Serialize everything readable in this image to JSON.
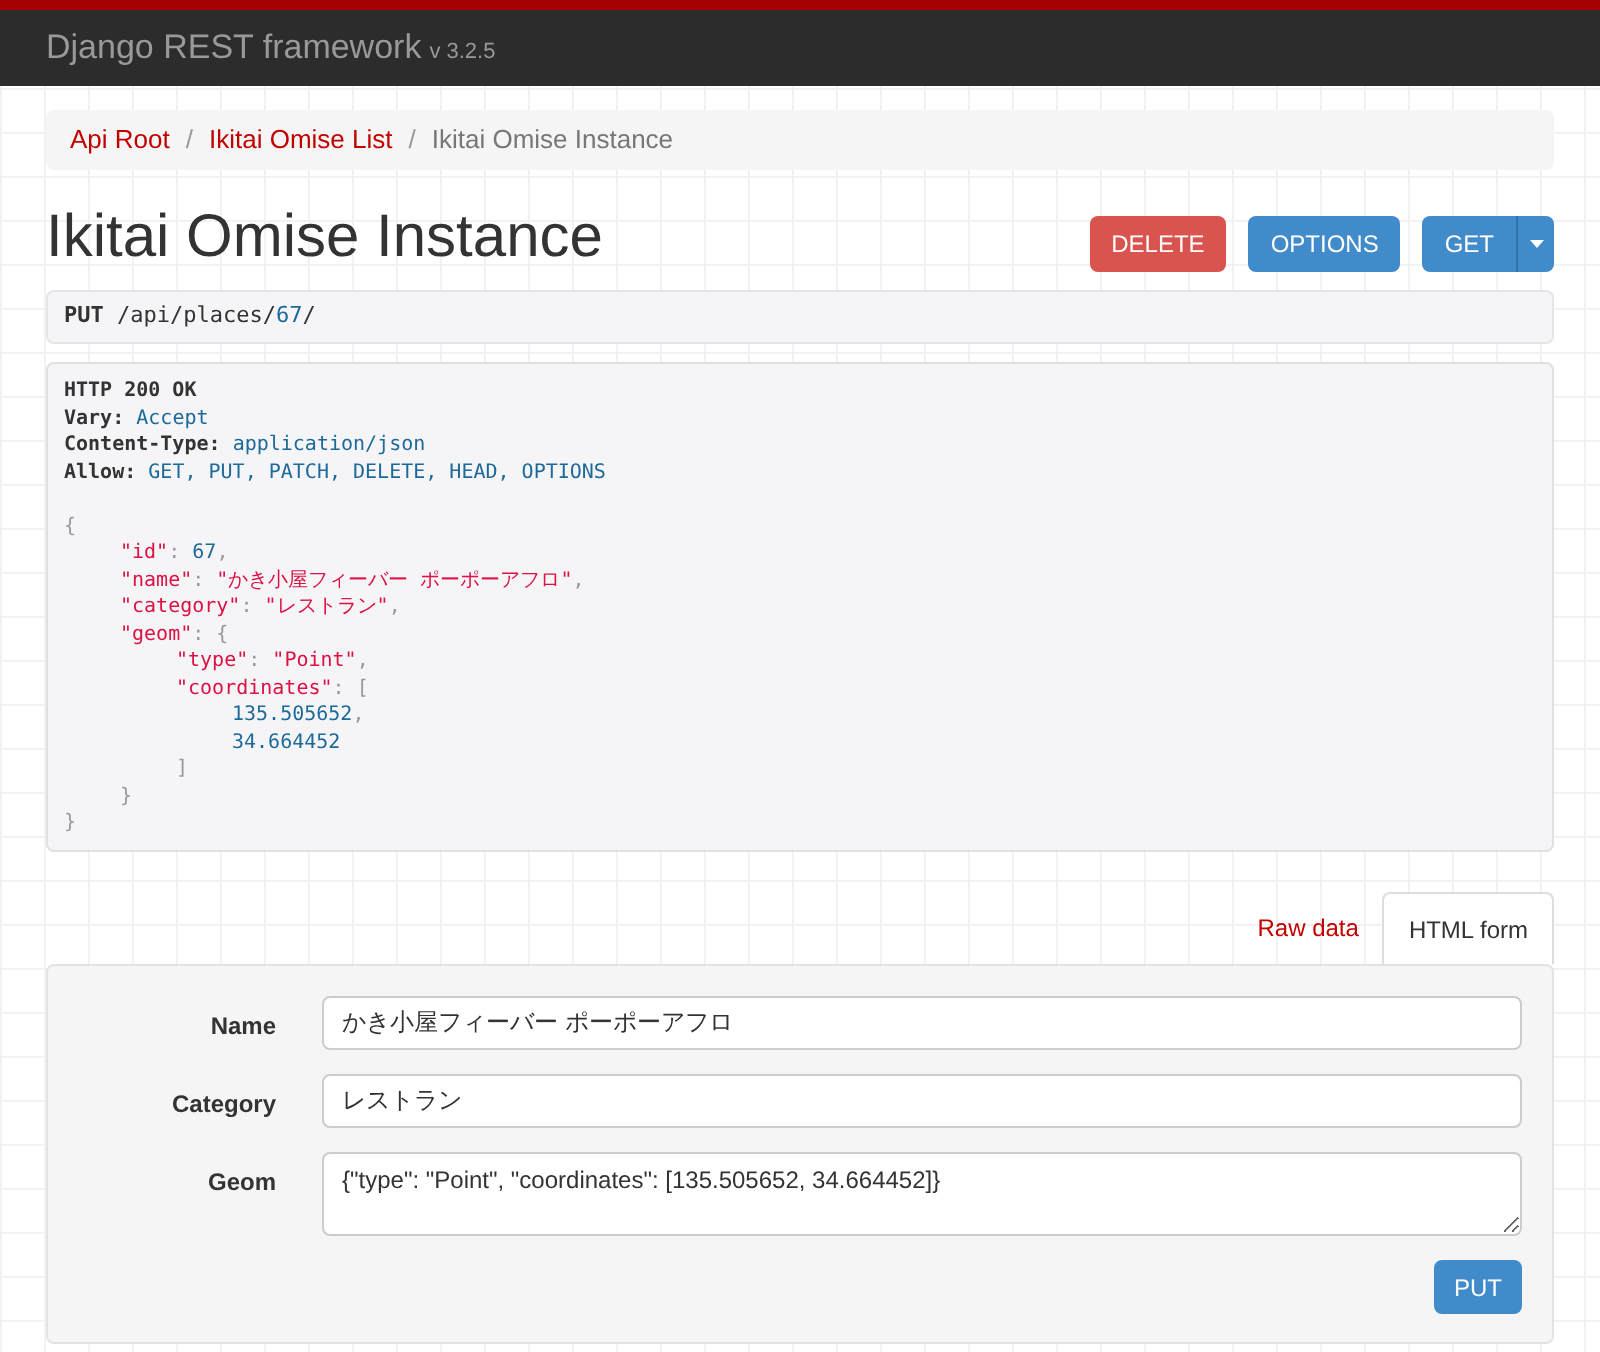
{
  "navbar": {
    "brand": "Django REST framework",
    "version": "v 3.2.5"
  },
  "breadcrumbs": [
    {
      "label": "Api Root",
      "selected": false
    },
    {
      "separator": "/",
      "label": "Ikitai Omise List",
      "selected": false
    },
    {
      "separator": "/",
      "label": "Ikitai Omise Instance",
      "selected": true
    }
  ],
  "title": "Ikitai Omise Instance",
  "actions": [
    {
      "label": "DELETE",
      "kind": "danger"
    },
    {
      "label": "OPTIONS",
      "kind": "primary"
    },
    {
      "label": "GET",
      "kind": "split"
    }
  ],
  "request": {
    "method": "PUT",
    "path": "/api/places/",
    "id": "67",
    "trail": "/"
  },
  "response": {
    "status": "HTTP 200 OK",
    "headers": [
      {
        "key": "Vary:",
        "value": "Accept"
      },
      {
        "key": "Content-Type:",
        "value": "application/json"
      },
      {
        "key": "Allow:",
        "value": "GET, PUT, PATCH, DELETE, HEAD, OPTIONS"
      }
    ],
    "body": [
      {
        "tokens": [
          {
            "kind": "punct",
            "text": "{"
          }
        ],
        "close": [
          {
            "kind": "punct",
            "text": "}"
          }
        ],
        "children": [
          {
            "tokens": [
              {
                "kind": "string",
                "text": "\"id\""
              },
              {
                "kind": "punct",
                "text": ": "
              },
              {
                "kind": "number",
                "text": "67"
              },
              {
                "kind": "punct",
                "text": ","
              }
            ]
          },
          {
            "tokens": [
              {
                "kind": "string",
                "text": "\"name\""
              },
              {
                "kind": "punct",
                "text": ": "
              },
              {
                "kind": "string",
                "text": "\"かき小屋フィーバー ポーポーアフロ\""
              },
              {
                "kind": "punct",
                "text": ","
              }
            ]
          },
          {
            "tokens": [
              {
                "kind": "string",
                "text": "\"category\""
              },
              {
                "kind": "punct",
                "text": ": "
              },
              {
                "kind": "string",
                "text": "\"レストラン\""
              },
              {
                "kind": "punct",
                "text": ","
              }
            ]
          },
          {
            "tokens": [
              {
                "kind": "string",
                "text": "\"geom\""
              },
              {
                "kind": "punct",
                "text": ": {"
              }
            ],
            "close": [
              {
                "kind": "punct",
                "text": "}"
              }
            ],
            "children": [
              {
                "tokens": [
                  {
                    "kind": "string",
                    "text": "\"type\""
                  },
                  {
                    "kind": "punct",
                    "text": ": "
                  },
                  {
                    "kind": "string",
                    "text": "\"Point\""
                  },
                  {
                    "kind": "punct",
                    "text": ","
                  }
                ]
              },
              {
                "tokens": [
                  {
                    "kind": "string",
                    "text": "\"coordinates\""
                  },
                  {
                    "kind": "punct",
                    "text": ": ["
                  }
                ],
                "close": [
                  {
                    "kind": "punct",
                    "text": "]"
                  }
                ],
                "children": [
                  {
                    "tokens": [
                      {
                        "kind": "number",
                        "text": "135.505652"
                      },
                      {
                        "kind": "punct",
                        "text": ","
                      }
                    ]
                  },
                  {
                    "tokens": [
                      {
                        "kind": "number",
                        "text": "34.664452"
                      }
                    ]
                  }
                ]
              }
            ]
          }
        ]
      }
    ]
  },
  "form_tabs": [
    {
      "label": "Raw data",
      "selected": false
    },
    {
      "label": "HTML form",
      "selected": true
    }
  ],
  "form": {
    "fields": [
      {
        "label": "Name",
        "value": "かき小屋フィーバー ポーポーアフロ",
        "kind": "input"
      },
      {
        "label": "Category",
        "value": "レストラン",
        "kind": "input"
      },
      {
        "label": "Geom",
        "value": "{\"type\": \"Point\", \"coordinates\": [135.505652, 34.664452]}",
        "kind": "textarea"
      }
    ],
    "submit": "PUT"
  }
}
